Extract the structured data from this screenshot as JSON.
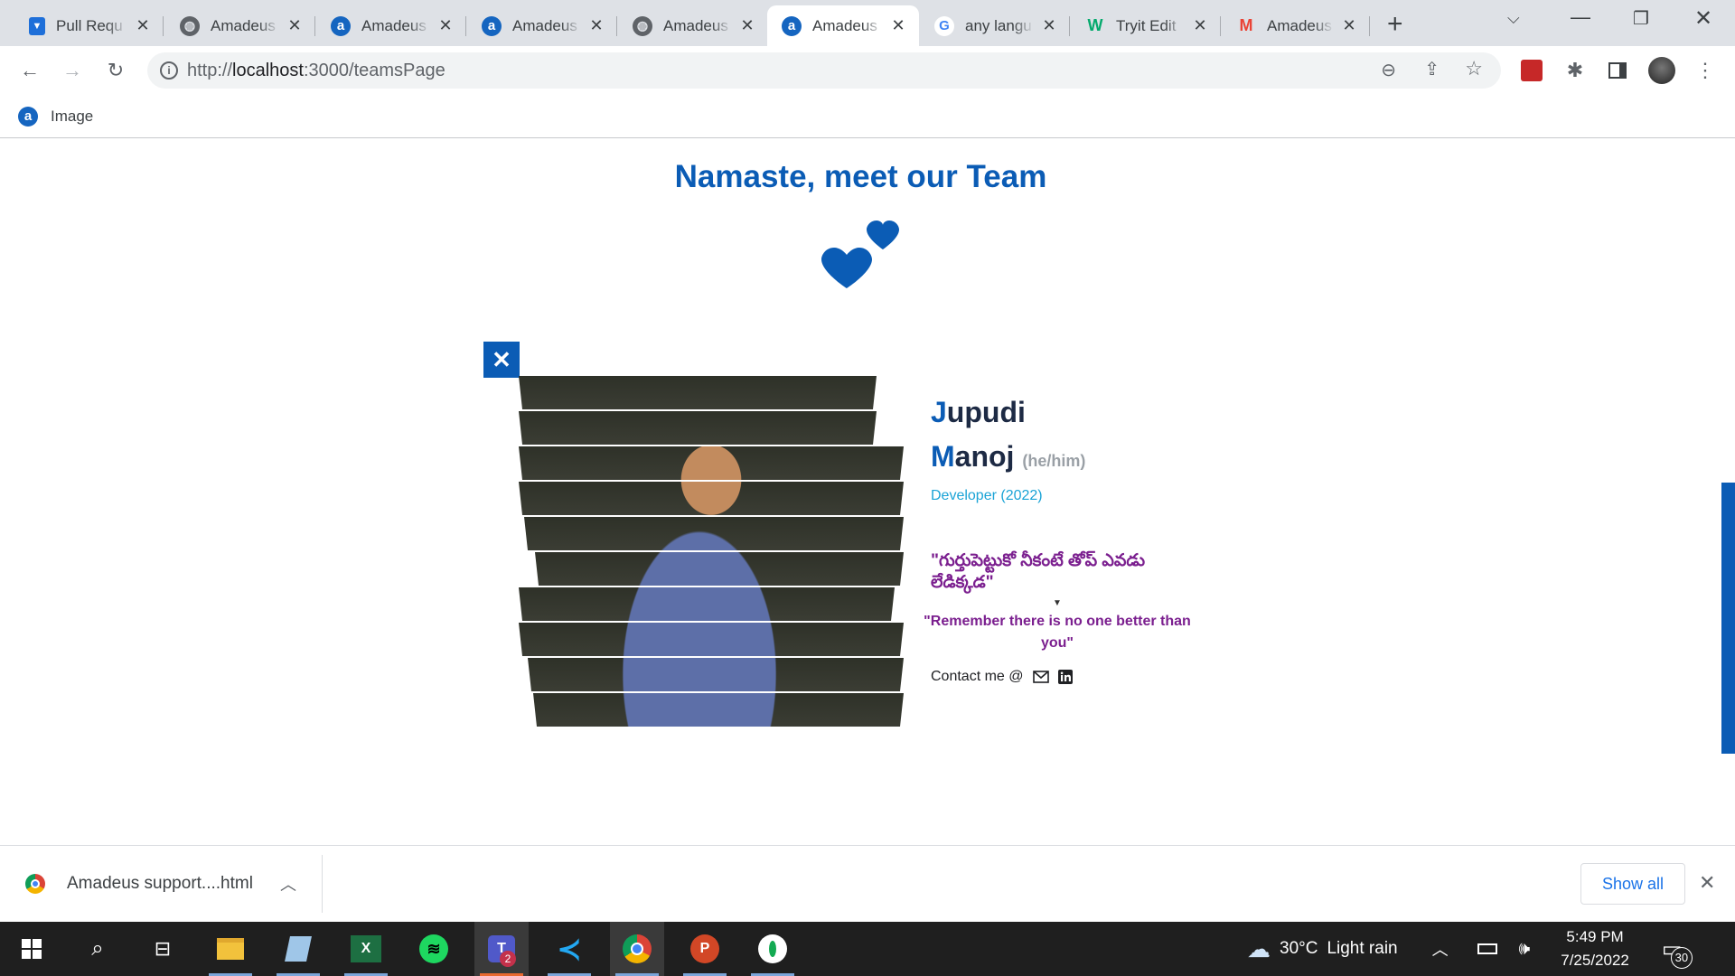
{
  "browser": {
    "tabs": [
      {
        "title": "Pull Requ",
        "icon": "azure-devops-icon",
        "active": false
      },
      {
        "title": "Amadeus",
        "icon": "globe-icon",
        "active": false
      },
      {
        "title": "Amadeus",
        "icon": "amadeus-icon",
        "active": false
      },
      {
        "title": "Amadeus",
        "icon": "amadeus-icon",
        "active": false
      },
      {
        "title": "Amadeus",
        "icon": "globe-icon",
        "active": false
      },
      {
        "title": "Amadeus",
        "icon": "amadeus-icon",
        "active": true
      },
      {
        "title": "any langu",
        "icon": "google-icon",
        "active": false
      },
      {
        "title": "Tryit Edit",
        "icon": "w3schools-icon",
        "active": false
      },
      {
        "title": "Amadeus",
        "icon": "gmail-icon",
        "active": false
      }
    ],
    "new_tab": "+",
    "url_prefix": "http://",
    "url_host": "localhost",
    "url_path": ":3000/teamsPage",
    "bookmark_label": "Image"
  },
  "page": {
    "title": "Namaste, meet our Team",
    "close_label": "✕",
    "member": {
      "first_initial": "J",
      "first_rest": "upudi",
      "last_initial": "M",
      "last_rest": "anoj",
      "pronouns": "(he/him)",
      "role": "Developer (2022)",
      "quote_telugu": "\"గుర్తుపెట్టుకో నీకంటే తోప్ ఎవడు లేడిక్కడ\"",
      "quote_english": "\"Remember there is no one better than you\"",
      "contact_label": "Contact me @"
    }
  },
  "downloads": {
    "filename": "Amadeus support....html",
    "show_all": "Show all"
  },
  "taskbar": {
    "weather_temp": "30°C",
    "weather_desc": "Light rain",
    "time": "5:49 PM",
    "date": "7/25/2022",
    "notification_count": "30",
    "teams_badge": "2"
  },
  "colors": {
    "brand_blue": "#0b5cb5",
    "quote_purple": "#7b1f8f",
    "role_cyan": "#1aa3d6"
  }
}
